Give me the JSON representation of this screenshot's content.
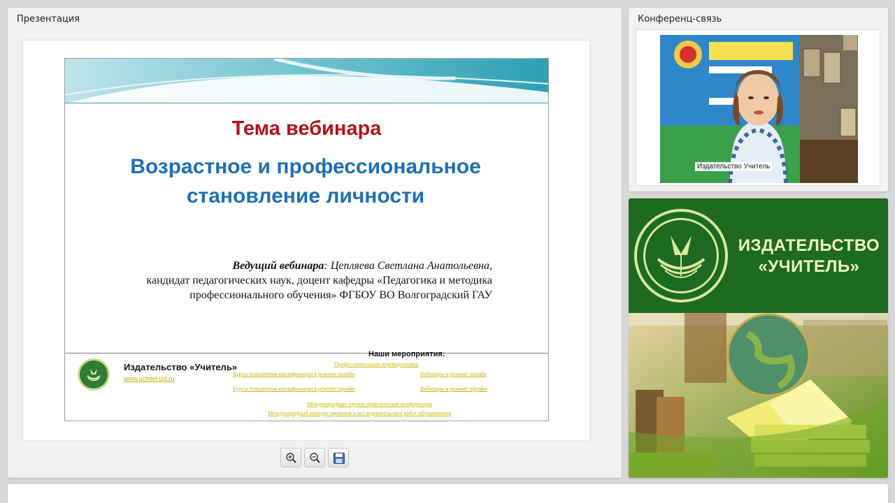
{
  "presentation": {
    "title": "Презентация",
    "slide": {
      "topic_heading": "Тема вебинара",
      "title_line1": "Возрастное и профессиональное",
      "title_line2": "становление личности",
      "host_label": "Ведущий вебинара",
      "host_name": "Цепляева Светлана Анатольевна,",
      "host_line2": "кандидат педагогических наук,  доцент кафедры «Педагогика и методика",
      "host_line3": "профессионального обучения» ФГБОУ ВО Волгоградский ГАУ",
      "publisher_name": "Издательство «Учитель»",
      "publisher_url": "www.uchitel-izd.ru",
      "events_title": "Наши мероприятия:",
      "events": [
        "Профессиональная переподготовка",
        "Курсы повышения квалификации в режиме онлайн",
        "Вебинары в режиме онлайн",
        "Курсы повышения квалификации в режиме офлайн",
        "Вебинары в режиме офлайн",
        "Международные научно-практические конференции",
        "Международный конкурс проектов и исследовательских работ обучающихся"
      ]
    },
    "toolbar": {
      "zoom_in": "zoom-in-icon",
      "zoom_out": "zoom-out-icon",
      "save": "save-icon"
    }
  },
  "conference": {
    "title": "Конференц-связь",
    "video_caption": "Издательство Учитель"
  },
  "ad": {
    "brand_line1": "ИЗДАТЕЛЬСТВО",
    "brand_line2": "«УЧИТЕЛЬ»",
    "colors": {
      "green": "#1d6a22",
      "cream": "#f3f7c8"
    }
  }
}
